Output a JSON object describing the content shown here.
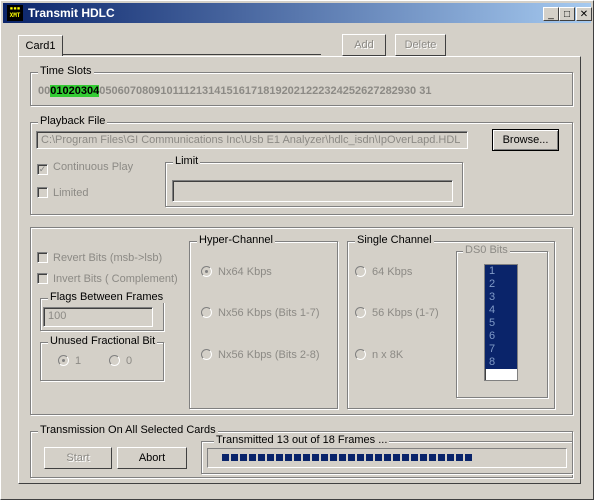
{
  "window": {
    "title": "Transmit HDLC",
    "icon_label": "TRANSMIT"
  },
  "title_buttons": {
    "minimize": "_",
    "maximize": "□",
    "close": "✕"
  },
  "tabs": {
    "card_tab": "Card1",
    "add_label": "Add",
    "delete_label": "Delete"
  },
  "time_slots": {
    "label": "Time Slots",
    "prefix": "00",
    "selected": [
      "01",
      "02",
      "03",
      "04"
    ],
    "rest": "0506070809101112131415161718192021222324252627282930 31"
  },
  "playback": {
    "label": "Playback File",
    "path": "C:\\Program Files\\GI Communications Inc\\Usb E1 Analyzer\\hdlc_isdn\\IpOverLapd.HDL",
    "browse_label": "Browse...",
    "continuous_label": "Continuous Play",
    "continuous_checked": true,
    "limited_label": "Limited",
    "limited_checked": false,
    "limit_label": "Limit",
    "limit_value": ""
  },
  "options": {
    "revert_label": "Revert Bits (msb->lsb)",
    "invert_label": "Invert Bits ( Complement)",
    "flags_label": "Flags Between Frames",
    "flags_value": "100",
    "unused_label": "Unused Fractional Bit",
    "unused_one": "1",
    "unused_zero": "0"
  },
  "hyper": {
    "label": "Hyper-Channel",
    "opt1": "Nx64 Kbps",
    "opt2": "Nx56 Kbps (Bits 1-7)",
    "opt3": "Nx56 Kbps (Bits 2-8)"
  },
  "single": {
    "label": "Single Channel",
    "opt1": "64 Kbps",
    "opt2": "56 Kbps (1-7)",
    "opt3": "n x 8K",
    "ds0_label": "DS0 Bits",
    "ds0_items": [
      "1",
      "2",
      "3",
      "4",
      "5",
      "6",
      "7",
      "8"
    ]
  },
  "transmission": {
    "label": "Transmission On All Selected Cards",
    "start_label": "Start",
    "abort_label": "Abort",
    "status": "Transmitted 13 out of 18 Frames ...",
    "progress": 0.72
  }
}
